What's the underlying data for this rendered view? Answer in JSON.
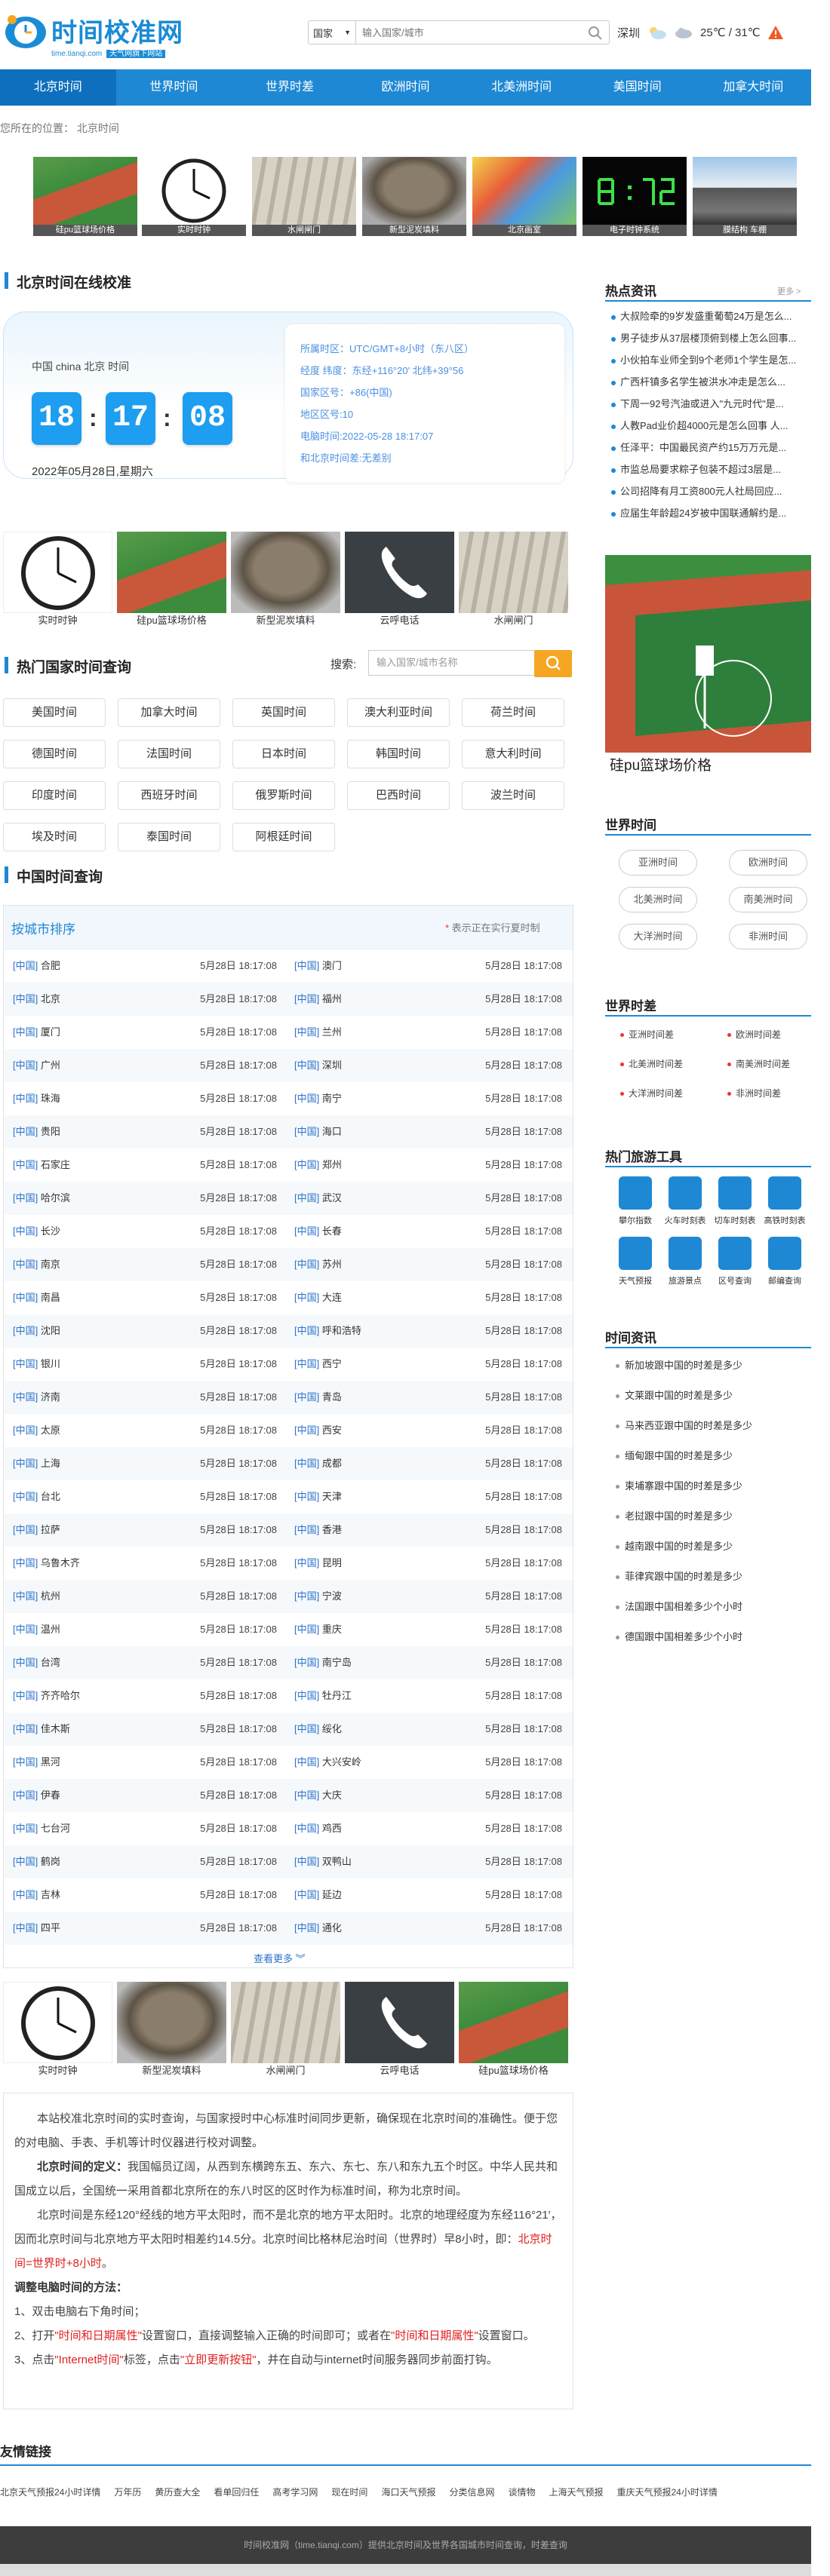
{
  "header": {
    "logo_title": "时间校准网",
    "logo_url": "time.tianqi.com",
    "logo_tag": "天气网旗下网站",
    "country_select": "国家",
    "search_placeholder": "输入国家/城市",
    "weather_city": "深圳",
    "weather_temp": "25℃ / 31℃"
  },
  "nav": [
    "北京时间",
    "世界时间",
    "世界时差",
    "欧洲时间",
    "北美洲时间",
    "美国时间",
    "加拿大时间"
  ],
  "breadcrumb": "您所在的位置：  北京时间",
  "top_strip": [
    "硅pu篮球场价格",
    "实时时钟",
    "水闸闸门",
    "新型泥炭填料",
    "北京画室",
    "电子时钟系统",
    "膜结构 车棚"
  ],
  "clock": {
    "title": "北京时间在线校准",
    "city": "中国 china 北京 时间",
    "hour": "18",
    "minute": "17",
    "second": "08",
    "date": "2022年05月28日,星期六",
    "info": [
      "所属时区：UTC/GMT+8小时（东八区）",
      "经度 纬度：东经+116°20' 北纬+39°56",
      "国家区号：+86(中国)",
      "地区区号:10",
      "电脑时间:2022-05-28 18:17:07",
      "和北京时间差:无差别"
    ]
  },
  "mid_strip": [
    "实时时钟",
    "硅pu篮球场价格",
    "新型泥炭填料",
    "云呼电话",
    "水闸闸门"
  ],
  "hot": {
    "title": "热门国家时间查询",
    "search_label": "搜索:",
    "search_placeholder": "输入国家/城市名称",
    "countries": [
      "美国时间",
      "加拿大时间",
      "英国时间",
      "澳大利亚时间",
      "荷兰时间",
      "德国时间",
      "法国时间",
      "日本时间",
      "韩国时间",
      "意大利时间",
      "印度时间",
      "西班牙时间",
      "俄罗斯时间",
      "巴西时间",
      "波兰时间",
      "埃及时间",
      "泰国时间",
      "阿根廷时间"
    ]
  },
  "china": {
    "title": "中国时间查询",
    "sort_label": "按城市排序",
    "note_star": "*",
    "note": " 表示正在实行夏时制",
    "tag": "[中国]",
    "time": "5月28日 18:17:08",
    "rows": [
      [
        "合肥",
        "澳门"
      ],
      [
        "北京",
        "福州"
      ],
      [
        "厦门",
        "兰州"
      ],
      [
        "广州",
        "深圳"
      ],
      [
        "珠海",
        "南宁"
      ],
      [
        "贵阳",
        "海口"
      ],
      [
        "石家庄",
        "郑州"
      ],
      [
        "哈尔滨",
        "武汉"
      ],
      [
        "长沙",
        "长春"
      ],
      [
        "南京",
        "苏州"
      ],
      [
        "南昌",
        "大连"
      ],
      [
        "沈阳",
        "呼和浩特"
      ],
      [
        "银川",
        "西宁"
      ],
      [
        "济南",
        "青岛"
      ],
      [
        "太原",
        "西安"
      ],
      [
        "上海",
        "成都"
      ],
      [
        "台北",
        "天津"
      ],
      [
        "拉萨",
        "香港"
      ],
      [
        "乌鲁木齐",
        "昆明"
      ],
      [
        "杭州",
        "宁波"
      ],
      [
        "温州",
        "重庆"
      ],
      [
        "台湾",
        "南宁岛"
      ],
      [
        "齐齐哈尔",
        "牡丹江"
      ],
      [
        "佳木斯",
        "绥化"
      ],
      [
        "黑河",
        "大兴安岭"
      ],
      [
        "伊春",
        "大庆"
      ],
      [
        "七台河",
        "鸡西"
      ],
      [
        "鹤岗",
        "双鸭山"
      ],
      [
        "吉林",
        "延边"
      ],
      [
        "四平",
        "通化"
      ]
    ],
    "more": "查看更多"
  },
  "bottom_strip": [
    "实时时钟",
    "新型泥炭填料",
    "水闸闸门",
    "云呼电话",
    "硅pu篮球场价格"
  ],
  "article": {
    "p1": "本站校准北京时间的实时查询，与国家授时中心标准时间同步更新，确保现在北京时间的准确性。便于您的对电脑、手表、手机等计时仪器进行校对调整。",
    "def_label": "北京时间的定义：",
    "p2": "我国幅员辽阔，从西到东横跨东五、东六、东七、东八和东九五个时区。中华人民共和国成立以后，全国统一采用首都北京所在的东八时区的区时作为标准时间，称为北京时间。",
    "p3": "北京时间是东经120°经线的地方平太阳时，而不是北京的地方平太阳时。北京的地理经度为东经116°21′，因而北京时间与北京地方平太阳时相差约14.5分。北京时间比格林尼治时间（世界时）早8小时，即：",
    "p3_red": "北京时间=世界时+8小时",
    "p3_end": "。",
    "how_label": "调整电脑时间的方法：",
    "s1": "1、双击电脑右下角时间；",
    "s2a": "2、打开",
    "s2b": "\"时间和日期属性\"",
    "s2c": "设置窗口，直接调整输入正确的时间即可；或者在",
    "s2d": "\"时间和日期属性\"",
    "s2e": "设置窗口。",
    "s3a": "3、点击",
    "s3b": "\"Internet时间\"",
    "s3c": "标签，点击",
    "s3d": "\"立即更新按钮\"",
    "s3e": "，并在自动与internet时间服务器同步前面打钩。"
  },
  "friends": {
    "title": "友情链接",
    "links": [
      "北京天气预报24小时详情",
      "万年历",
      "黄历查大全",
      "看单回归任",
      "高考学习网",
      "现在时间",
      "海口天气预报",
      "分类信息网",
      "谈情物",
      "上海天气预报",
      "重庆天气预报24小时详情"
    ]
  },
  "footer": "时间校准网（time.tianqi.com）提供北京时间及世界各国城市时间查询，时差查询",
  "sidebar": {
    "hot_title": "热点资讯",
    "hot_more": "更多 >",
    "hot_news": [
      "大叔险牵的9岁发盛重葡萄24万是怎么...",
      "男子徒步从37层楼顶俯到楼上怎么回事...",
      "小伙拍车业师全到9个老师1个学生是怎...",
      "广西杆镇多名学生被洪水冲走是怎么...",
      "下周一92号汽油或进入\"九元时代\"是...",
      "人教Pad业价超4000元是怎么回事 人...",
      "任泽平：中国最民资产约15万万元是...",
      "市监总局要求粽子包装不超过3层是...",
      "公司招降有月工资800元人社局回应...",
      "应届生年龄超24岁被中国联通解约是..."
    ],
    "ad_caption": "硅pu篮球场价格",
    "world_title": "世界时间",
    "world": [
      "亚洲时间",
      "欧洲时间",
      "北美洲时间",
      "南美洲时间",
      "大洋洲时间",
      "非洲时间"
    ],
    "diff_title": "世界时差",
    "diff": [
      "亚洲时间差",
      "欧洲时间差",
      "北美洲时间差",
      "南美洲时间差",
      "大洋洲时间差",
      "非洲时间差"
    ],
    "tools_title": "热门旅游工具",
    "tools": [
      "攀尔指数",
      "火车时刻表",
      "切车时刻表",
      "高铁时刻表",
      "天气预报",
      "旅游景点",
      "区号查询",
      "邮编查询"
    ],
    "tinfo_title": "时间资讯",
    "tinfo": [
      "新加坡跟中国的时差是多少",
      "文莱跟中国的时差是多少",
      "马来西亚跟中国的时差是多少",
      "缅甸跟中国的时差是多少",
      "柬埔寨跟中国的时差是多少",
      "老挝跟中国的时差是多少",
      "越南跟中国的时差是多少",
      "菲律宾跟中国的时差是多少",
      "法国跟中国相差多少个小时",
      "德国跟中国相差多少个小时"
    ]
  }
}
